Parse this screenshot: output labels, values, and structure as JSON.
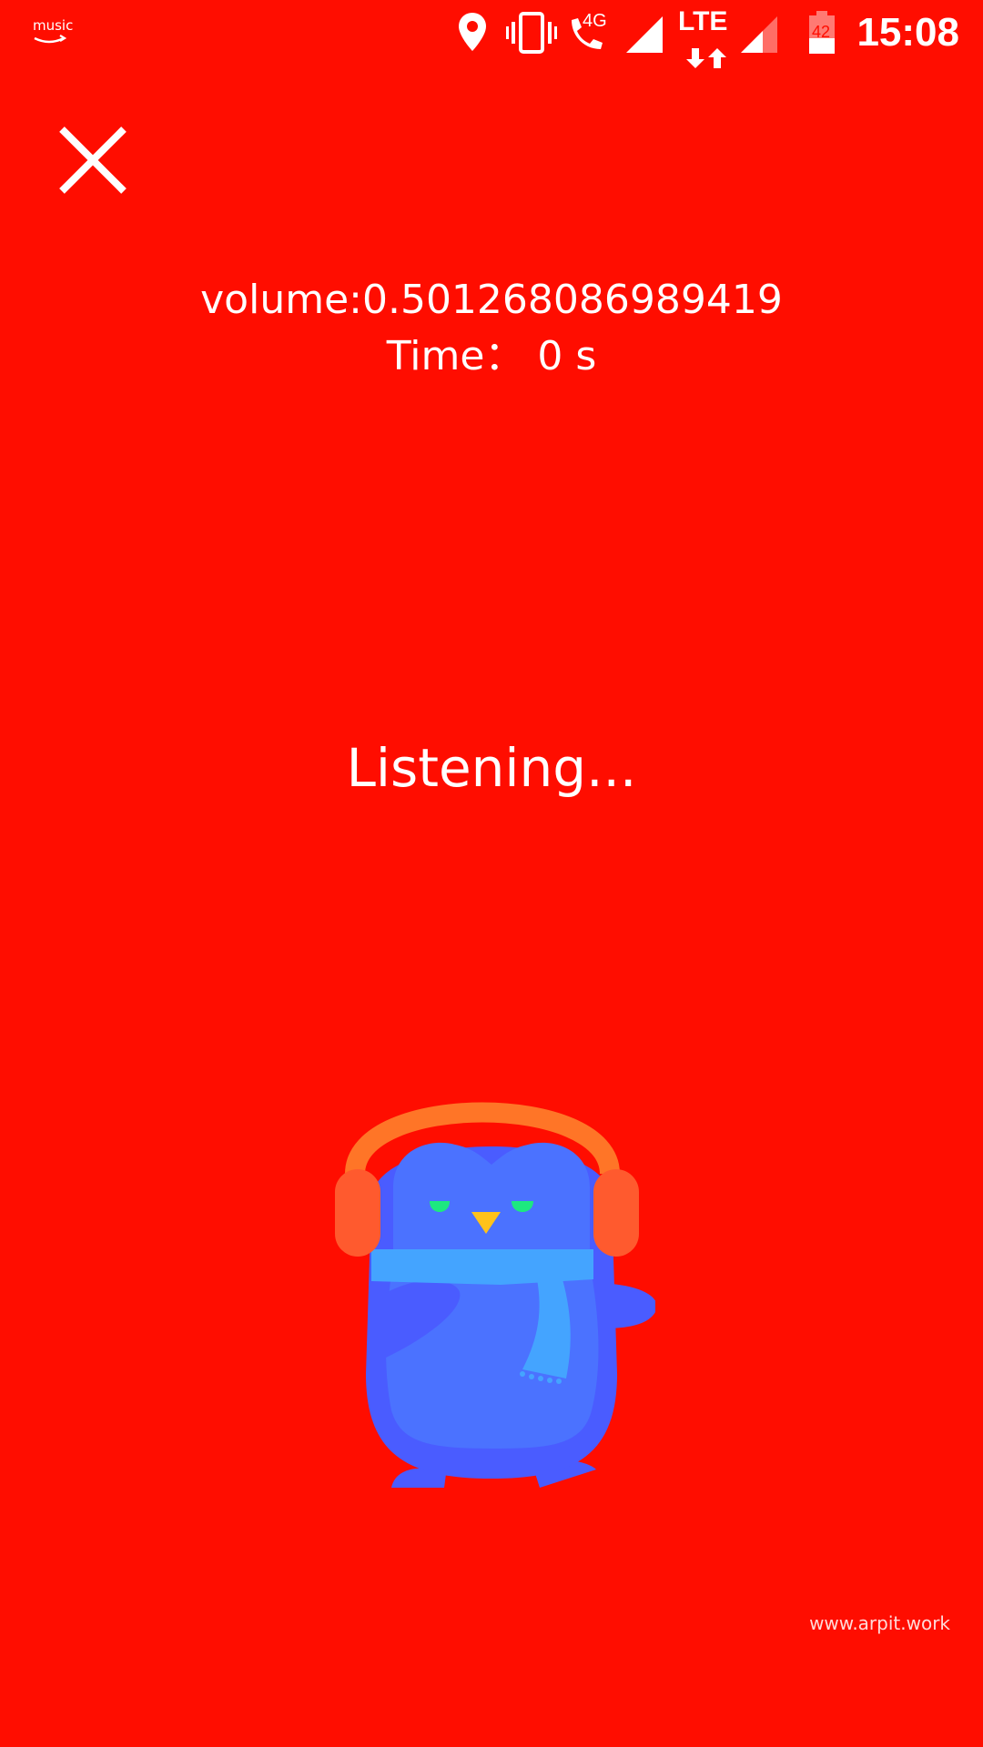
{
  "status_bar": {
    "app_icon_text": "music",
    "network_type": "4G",
    "lte_label": "LTE",
    "battery_level": "42",
    "time": "15:08",
    "icons": [
      "amazon-music-icon",
      "location-icon",
      "vibrate-icon",
      "wifi-calling-icon",
      "signal-icon",
      "lte-data-icon",
      "signal-icon-2",
      "battery-icon"
    ]
  },
  "close_button": {
    "icon": "close-icon"
  },
  "info": {
    "volume": "volume:0.501268086989419",
    "time": "Time： 0 s"
  },
  "status_message": "Listening...",
  "mascot": {
    "description_icon": "penguin-headphones-icon"
  },
  "watermark": "www.arpit.work",
  "colors": {
    "background": "#ff0d00",
    "text": "#ffffff",
    "penguin_body": "#4a5cff",
    "penguin_belly": "#4b72ff",
    "scarf": "#44a4ff",
    "headphones": "#ff7527",
    "ear_cups": "#ff5a2e",
    "eyes": "#1de87f",
    "beak": "#ffc21a"
  }
}
